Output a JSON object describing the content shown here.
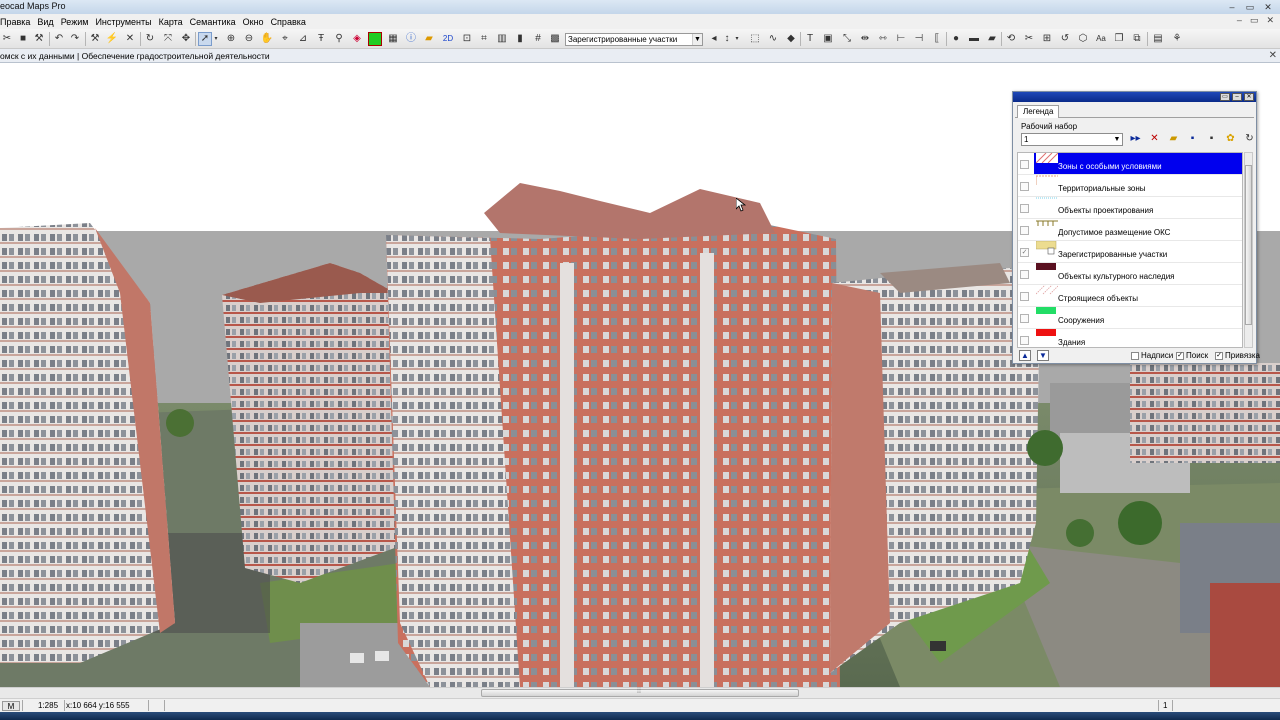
{
  "window": {
    "title": "eocad Maps Pro",
    "title_buttons": [
      "‒",
      "▭",
      "✕"
    ]
  },
  "menu": {
    "items": [
      "Правка",
      "Вид",
      "Режим",
      "Инструменты",
      "Карта",
      "Семантика",
      "Окно",
      "Справка"
    ]
  },
  "toolbar": {
    "mode_2d": "2D",
    "layer_dropdown_value": "Зарегистрированные участки"
  },
  "document_tab": {
    "text": "омск с их данными | Обеспечение градостроительной деятельности",
    "close": "✕"
  },
  "legend": {
    "tab": "Легенда",
    "set_label": "Рабочий набор",
    "set_value": "1",
    "layers": [
      {
        "label": "Зоны с особыми условиями",
        "selected": true,
        "checked": false
      },
      {
        "label": "Территориальные зоны",
        "selected": false,
        "checked": false
      },
      {
        "label": "Объекты проектирования",
        "selected": false,
        "checked": false
      },
      {
        "label": "Допустимое размещение ОКС",
        "selected": false,
        "checked": false
      },
      {
        "label": "Зарегистрированные участки",
        "selected": false,
        "checked": true
      },
      {
        "label": "Объекты культурного наследия",
        "selected": false,
        "checked": false
      },
      {
        "label": "Строящиеся объекты",
        "selected": false,
        "checked": false
      },
      {
        "label": "Сооружения",
        "selected": false,
        "checked": false
      },
      {
        "label": "Здания",
        "selected": false,
        "checked": false
      }
    ],
    "options": {
      "labels": "Надписи",
      "search": "Поиск",
      "snap": "Привязка"
    },
    "colors": {
      "selected_bg": "#0000ee",
      "sooruzheniya": "#22dd66",
      "zdaniya": "#ee1111",
      "kultura": "#5a1020",
      "uchastki": "#ecdc90"
    }
  },
  "status": {
    "mode": "M",
    "scale": "1:285",
    "coords": "x:10 664 y:16 555",
    "page": "1"
  }
}
